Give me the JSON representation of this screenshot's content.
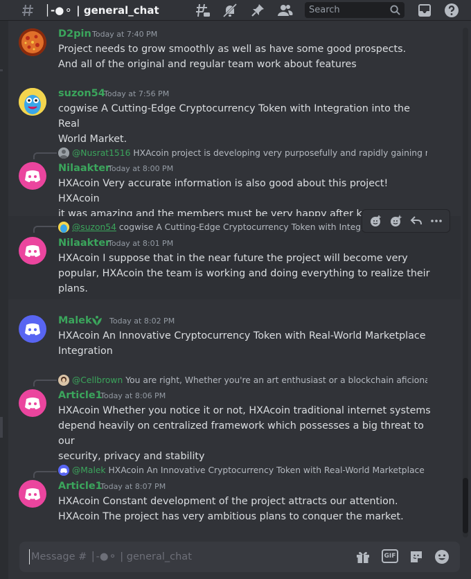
{
  "header": {
    "channel_prefix": "|•◆",
    "channel_name": "│-●⚬ | general_chat",
    "search_placeholder": "Search"
  },
  "messages": [
    {
      "username": "D2pin",
      "timestamp": "Today at 7:40 PM",
      "lines": [
        "Project needs to grow smoothly as well as have some good prospects.",
        "And all of the original and regular team work about features"
      ],
      "avatar": "pizza-avatar"
    },
    {
      "username": "suzon54",
      "timestamp": "Today at 7:56 PM",
      "lines": [
        "cogwise A Cutting-Edge Cryptocurrency Token with Integration into the Real",
        "World Market."
      ],
      "avatar": "blue-creature-avatar"
    },
    {
      "reply_mention": "@Nusrat1516",
      "reply_text": "HXAcoin project is developing very purposefully and rapidly gaining mom",
      "username": "Nilaakter",
      "timestamp": "Today at 8:00 PM",
      "lines": [
        "HXAcoin Very accurate information is also good about this project! HXAcoin",
        "it was amazing and the members must be very happy after knowing the news."
      ],
      "avatar": "discord-avatar"
    },
    {
      "reply_mention": "@suzon54",
      "reply_text": "cogwise A Cutting-Edge Cryptocurrency Token with Integra",
      "username": "Nilaakter",
      "timestamp": "Today at 8:01 PM",
      "lines": [
        "HXAcoin  I suppose that in the near future the project will become very",
        "popular, HXAcoin  the team is working and doing everything to realize their",
        "plans."
      ],
      "avatar": "discord-avatar"
    },
    {
      "username": "Malek",
      "timestamp": "Today at 8:02 PM",
      "lines": [
        "HXAcoin An Innovative Cryptocurrency Token with Real-World Marketplace",
        "Integration"
      ],
      "avatar": "discord-avatar"
    },
    {
      "reply_mention": "@Cellbrown",
      "reply_text": "You are right, Whether you're an art enthusiast or a blockchain aficionado",
      "username": "Article1",
      "timestamp": "Today at 8:06 PM",
      "lines": [
        "HXAcoin  Whether you notice it or not, HXAcoin  traditional internet systems",
        "depend heavily on centralized framework which possesses a big threat to our",
        "security, privacy and stability"
      ],
      "avatar": "discord-avatar"
    },
    {
      "reply_mention": "@Malek",
      "reply_text": "HXAcoin An Innovative Cryptocurrency Token with Real-World Marketplace In",
      "username": "Article1",
      "timestamp": "Today at 8:07 PM",
      "lines": [
        "HXAcoin  Constant development of the project attracts our attention.",
        "HXAcoin  The project has very ambitious plans to conquer the market."
      ],
      "avatar": "discord-avatar"
    }
  ],
  "composer": {
    "placeholder": "Message # │-●⚬ | general_chat",
    "gif_label": "GIF"
  },
  "colors": {
    "background": "#313338",
    "username_green": "#3ba55c",
    "discord_pink": "#eb459e",
    "discord_blurple": "#5865f2"
  }
}
